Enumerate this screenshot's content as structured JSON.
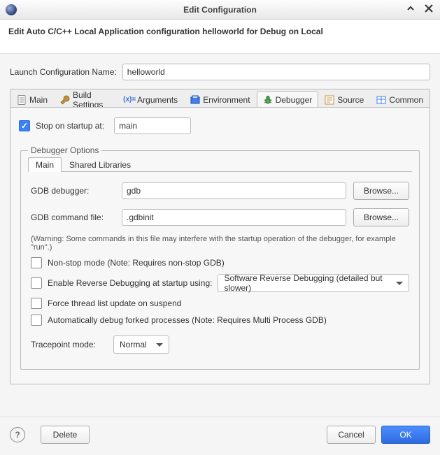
{
  "window": {
    "title": "Edit Configuration"
  },
  "header": {
    "text": "Edit Auto C/C++ Local Application configuration helloworld for Debug on Local"
  },
  "launch": {
    "label": "Launch Configuration Name:",
    "value": "helloworld"
  },
  "tabs": {
    "main": "Main",
    "build": "Build Settings",
    "arguments": "Arguments",
    "environment": "Environment",
    "debugger": "Debugger",
    "source": "Source",
    "common": "Common",
    "active": "debugger"
  },
  "debugger": {
    "stop_label": "Stop on startup at:",
    "stop_value": "main",
    "group_title": "Debugger Options",
    "subtabs": {
      "main": "Main",
      "shared": "Shared Libraries",
      "active": "main"
    },
    "gdb_label": "GDB debugger:",
    "gdb_value": "gdb",
    "gdb_browse": "Browse...",
    "cmdfile_label": "GDB command file:",
    "cmdfile_value": ".gdbinit",
    "cmdfile_browse": "Browse...",
    "warning": "(Warning: Some commands in this file may interfere with the startup operation of the debugger, for example \"run\".)",
    "nonstop_label": "Non-stop mode (Note: Requires non-stop GDB)",
    "reverse_label": "Enable Reverse Debugging at startup using:",
    "reverse_select": "Software Reverse Debugging (detailed but slower)",
    "force_label": "Force thread list update on suspend",
    "autofork_label": "Automatically debug forked processes (Note: Requires Multi Process GDB)",
    "tracepoint_label": "Tracepoint mode:",
    "tracepoint_value": "Normal"
  },
  "footer": {
    "delete": "Delete",
    "cancel": "Cancel",
    "ok": "OK"
  }
}
